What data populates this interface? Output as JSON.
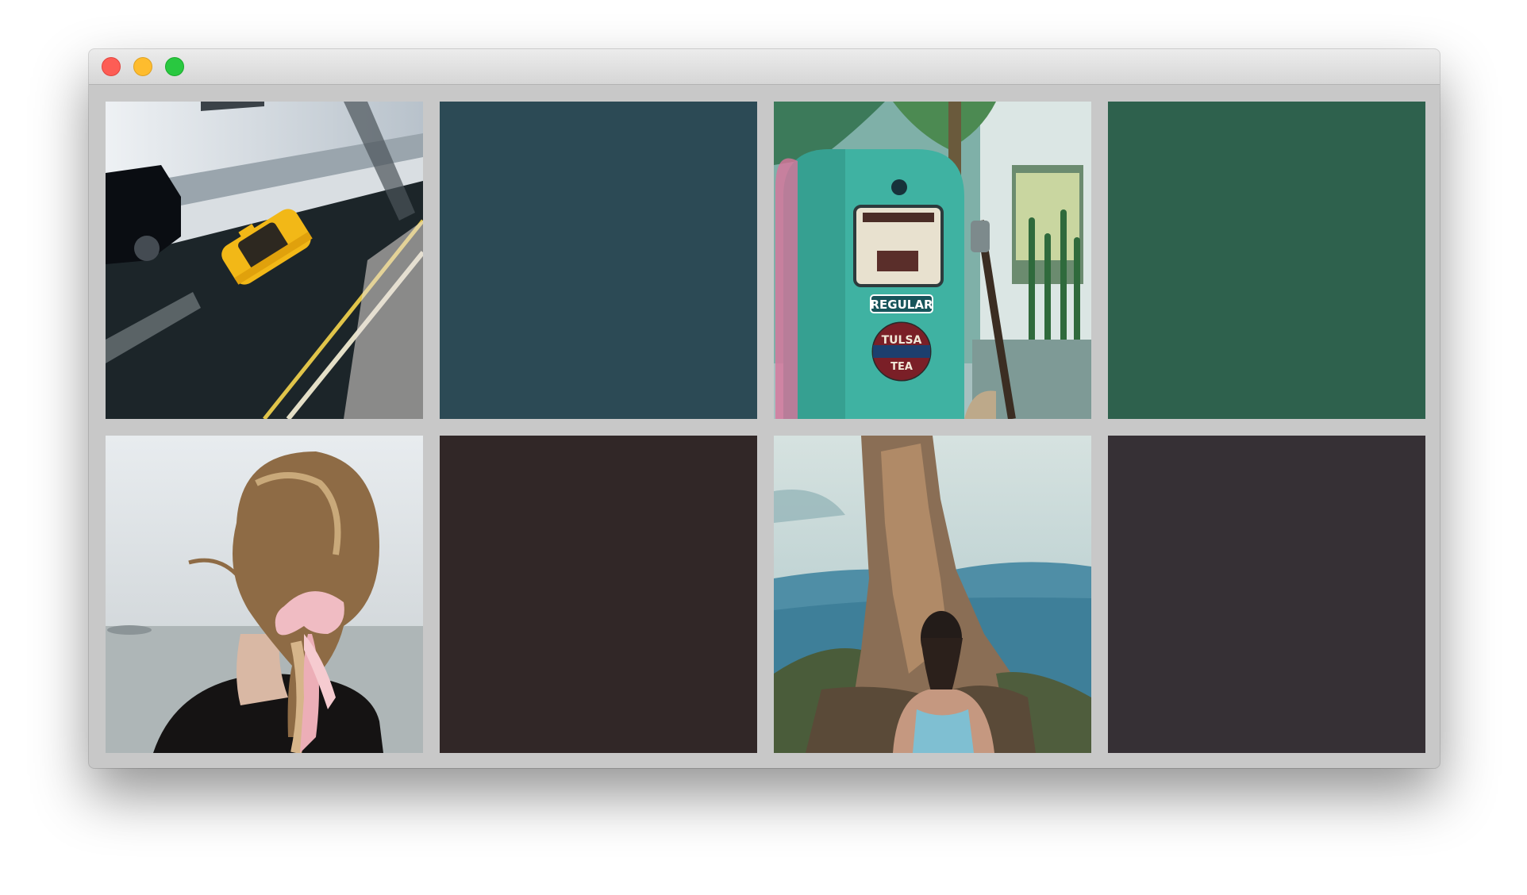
{
  "window": {
    "controls": [
      "close-button",
      "minimize-button",
      "zoom-button"
    ]
  },
  "tiles": [
    {
      "kind": "photo",
      "subject": "taxi-photo"
    },
    {
      "kind": "swatch",
      "color": "#2c4a55"
    },
    {
      "kind": "photo",
      "subject": "gas-pump-photo",
      "text": {
        "regular": "REGULAR",
        "tulsa": "TULSA",
        "tea": "TEA"
      }
    },
    {
      "kind": "swatch",
      "color": "#2e614d"
    },
    {
      "kind": "photo",
      "subject": "hair-ribbon-photo"
    },
    {
      "kind": "swatch",
      "color": "#312727"
    },
    {
      "kind": "photo",
      "subject": "rock-formation-photo"
    },
    {
      "kind": "swatch",
      "color": "#363035"
    }
  ]
}
